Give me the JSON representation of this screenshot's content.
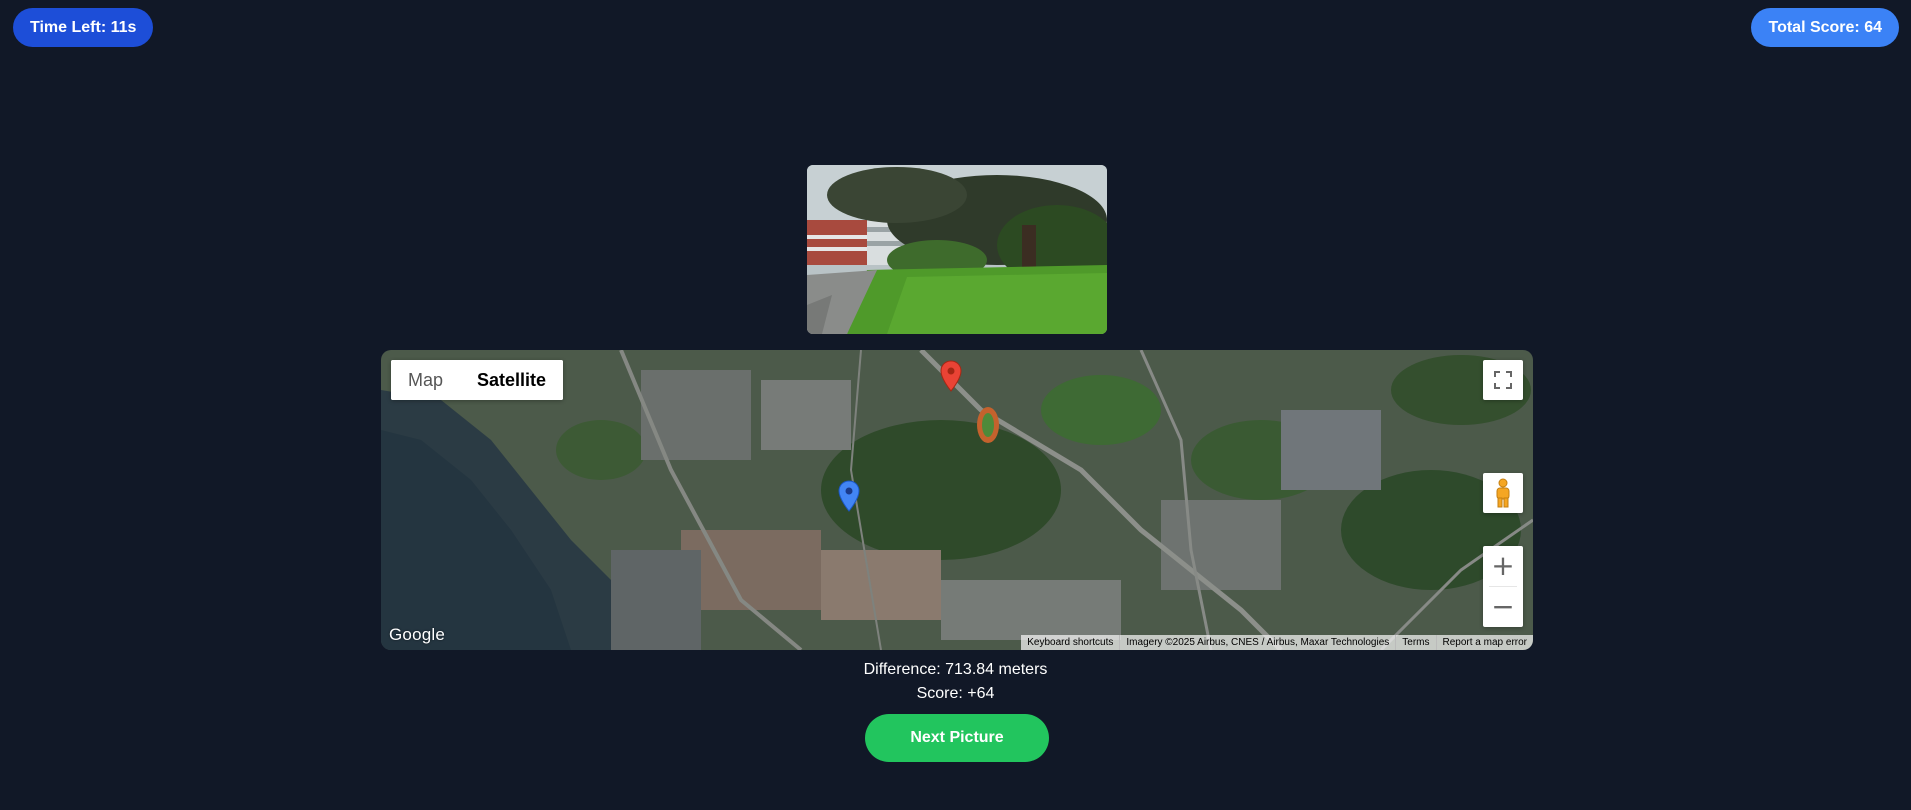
{
  "game": {
    "time_left": "Time Left: 11s",
    "total_score": "Total Score: 64"
  },
  "photo": {
    "description_icon": "photo-image"
  },
  "map": {
    "type_options": [
      "Map",
      "Satellite"
    ],
    "selected_type": "Satellite",
    "logo": "Google",
    "attribution": [
      "Keyboard shortcuts",
      "Imagery ©2025 Airbus, CNES / Airbus, Maxar Technologies",
      "Terms",
      "Report a map error"
    ],
    "controls": {
      "fullscreen_icon": "fullscreen-icon",
      "pegman_icon": "pegman-icon",
      "zoom_in": "+",
      "zoom_out": "−"
    },
    "markers": {
      "actual_color": "#ea4335",
      "guess_color": "#4285f4"
    }
  },
  "result": {
    "difference": "Difference: 713.84 meters",
    "score": "Score: +64"
  },
  "actions": {
    "next_label": "Next Picture"
  },
  "colors": {
    "background": "#111827",
    "time_pill": "#1d4ed8",
    "score_pill": "#3b82f6",
    "next_button": "#22c55e"
  }
}
